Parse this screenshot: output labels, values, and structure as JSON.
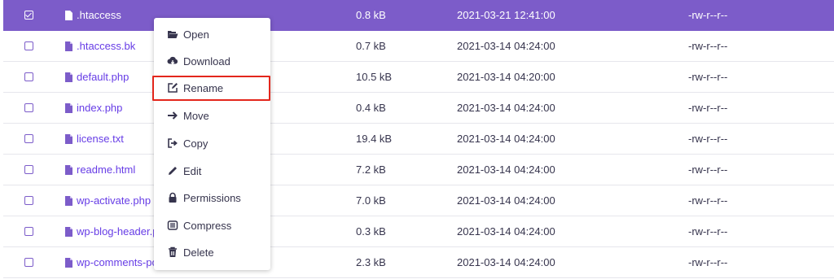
{
  "files": [
    {
      "name": ".htaccess",
      "size": "0.8 kB",
      "date": "2021-03-21 12:41:00",
      "perm": "-rw-r--r--",
      "selected": true
    },
    {
      "name": ".htaccess.bk",
      "size": "0.7 kB",
      "date": "2021-03-14 04:24:00",
      "perm": "-rw-r--r--"
    },
    {
      "name": "default.php",
      "size": "10.5 kB",
      "date": "2021-03-14 04:20:00",
      "perm": "-rw-r--r--"
    },
    {
      "name": "index.php",
      "size": "0.4 kB",
      "date": "2021-03-14 04:24:00",
      "perm": "-rw-r--r--"
    },
    {
      "name": "license.txt",
      "size": "19.4 kB",
      "date": "2021-03-14 04:24:00",
      "perm": "-rw-r--r--"
    },
    {
      "name": "readme.html",
      "size": "7.2 kB",
      "date": "2021-03-14 04:24:00",
      "perm": "-rw-r--r--"
    },
    {
      "name": "wp-activate.php",
      "size": "7.0 kB",
      "date": "2021-03-14 04:24:00",
      "perm": "-rw-r--r--"
    },
    {
      "name": "wp-blog-header.php",
      "size": "0.3 kB",
      "date": "2021-03-14 04:24:00",
      "perm": "-rw-r--r--"
    },
    {
      "name": "wp-comments-post.php",
      "size": "2.3 kB",
      "date": "2021-03-14 04:24:00",
      "perm": "-rw-r--r--"
    }
  ],
  "context_menu": [
    {
      "label": "Open",
      "icon": "folder-open-icon"
    },
    {
      "label": "Download",
      "icon": "cloud-download-icon"
    },
    {
      "label": "Rename",
      "icon": "rename-icon",
      "highlighted": true
    },
    {
      "label": "Move",
      "icon": "arrow-right-icon"
    },
    {
      "label": "Copy",
      "icon": "copy-icon"
    },
    {
      "label": "Edit",
      "icon": "pencil-icon"
    },
    {
      "label": "Permissions",
      "icon": "lock-icon"
    },
    {
      "label": "Compress",
      "icon": "compress-icon"
    },
    {
      "label": "Delete",
      "icon": "trash-icon"
    }
  ],
  "colors": {
    "accent": "#7c5cc9",
    "link": "#673de6",
    "highlight_border": "#e3261c",
    "text": "#36344d"
  }
}
